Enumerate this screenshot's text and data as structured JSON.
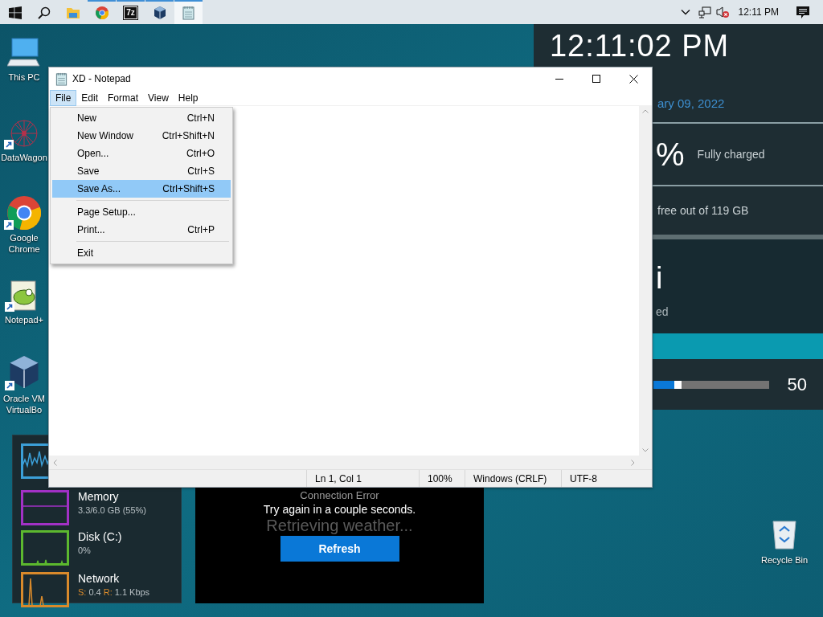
{
  "taskbar": {
    "apps": [
      {
        "kind": "start",
        "running": false,
        "active": false
      },
      {
        "kind": "search",
        "running": false,
        "active": false
      },
      {
        "kind": "folder",
        "running": false,
        "active": false
      },
      {
        "kind": "chrome",
        "running": true,
        "active": false
      },
      {
        "kind": "archive",
        "text": "7z",
        "running": true,
        "active": false
      },
      {
        "kind": "cube",
        "running": true,
        "active": false
      },
      {
        "kind": "notepad",
        "running": true,
        "active": true
      }
    ],
    "tray": {
      "time": "12:11 PM",
      "muted": true
    }
  },
  "desktop_icons": [
    {
      "kind": "computer",
      "label": "This PC",
      "shortcut": false
    },
    {
      "kind": "molecule",
      "label": "DataWagon",
      "shortcut": true
    },
    {
      "kind": "chrome",
      "label": "Google Chrome",
      "shortcut": true
    },
    {
      "kind": "notepadpp",
      "label": "Notepad+",
      "shortcut": true
    },
    {
      "kind": "cube",
      "label": "Oracle VM VirtualBo",
      "shortcut": true
    }
  ],
  "recycle_bin": {
    "label": "Recycle Bin"
  },
  "info_panel": {
    "clock": "12:11:02 PM",
    "date": "ary 09, 2022",
    "battery_percent": "%",
    "battery_status": "Fully charged",
    "disk": "free out of 119 GB",
    "wifi_name": "i",
    "wifi_status": "ed",
    "volume": {
      "level": 0.18,
      "reading": "50"
    }
  },
  "performance_widget": {
    "meters": [
      {
        "kind": "cpu",
        "color": "#3b9fd8"
      },
      {
        "kind": "memory",
        "color": "#a231c6",
        "name": "Memory",
        "detail": "3.3/6.0 GB (55%)"
      },
      {
        "kind": "disk",
        "color": "#5cb82f",
        "name": "Disk (C:)",
        "detail": "0%"
      },
      {
        "kind": "network",
        "color": "#d98a2b",
        "name": "Network",
        "sent_label": "S:",
        "sent": "0.4",
        "received_label": "R:",
        "received": "1.1 Kbps"
      }
    ]
  },
  "weather_widget": {
    "error_title": "Connection Error",
    "error_message": "Try again in a couple seconds.",
    "loading": "Retrieving weather...",
    "button": "Refresh"
  },
  "notepad": {
    "title": "XD - Notepad",
    "menus": [
      {
        "label": "File",
        "selected": true
      },
      {
        "label": "Edit",
        "selected": false
      },
      {
        "label": "Format",
        "selected": false
      },
      {
        "label": "View",
        "selected": false
      },
      {
        "label": "Help",
        "selected": false
      }
    ],
    "file_menu": [
      {
        "kind": "item",
        "label": "New",
        "shortcut": "Ctrl+N",
        "selected": false
      },
      {
        "kind": "item",
        "label": "New Window",
        "shortcut": "Ctrl+Shift+N",
        "selected": false
      },
      {
        "kind": "item",
        "label": "Open...",
        "shortcut": "Ctrl+O",
        "selected": false
      },
      {
        "kind": "item",
        "label": "Save",
        "shortcut": "Ctrl+S",
        "selected": false
      },
      {
        "kind": "item",
        "label": "Save As...",
        "shortcut": "Ctrl+Shift+S",
        "selected": true
      },
      {
        "kind": "separator"
      },
      {
        "kind": "item",
        "label": "Page Setup...",
        "selected": false
      },
      {
        "kind": "item",
        "label": "Print...",
        "shortcut": "Ctrl+P",
        "selected": false
      },
      {
        "kind": "separator"
      },
      {
        "kind": "item",
        "label": "Exit",
        "selected": false
      }
    ],
    "status_bar": [
      "Ln 1, Col 1",
      "100%",
      "Windows (CRLF)",
      "UTF-8"
    ]
  }
}
